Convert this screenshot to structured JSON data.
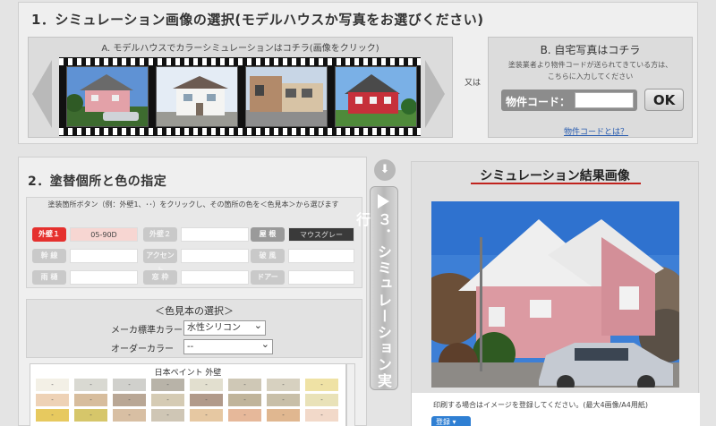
{
  "section1": {
    "title": "1．シミュレーション画像の選択(モデルハウスか写真をお選びください)",
    "model_label": "A. モデルハウスでカラーシミュレーションはコチラ(画像をクリック)",
    "or_label": "又は",
    "own_photo": {
      "title": "B. 自宅写真はコチラ",
      "desc_line1": "塗装業者より物件コードが送られてきている方は、",
      "desc_line2": "こちらに入力してください",
      "code_label": "物件コード：",
      "code_value": "",
      "ok_label": "OK",
      "help_link": "物件コードとは？"
    }
  },
  "section2": {
    "title": "2．塗替個所と色の指定",
    "instruction": "塗装箇所ボタン（例：外壁1、･･）をクリックし、その箇所の色を＜色見本＞から選びます",
    "parts": [
      {
        "label": "外壁１",
        "value": "05-90D"
      },
      {
        "label": "外壁２",
        "value": ""
      },
      {
        "label": "屋 根",
        "value": "マウスグレー"
      },
      {
        "label": "幹 線",
        "value": ""
      },
      {
        "label": "アクセント",
        "value": ""
      },
      {
        "label": "破 風",
        "value": ""
      },
      {
        "label": "雨 樋",
        "value": ""
      },
      {
        "label": "窓 枠",
        "value": ""
      },
      {
        "label": "ドアー",
        "value": ""
      }
    ],
    "swatch_title": "＜色見本の選択＞",
    "maker_label": "メーカ標準カラー",
    "maker_value": "水性シリコン",
    "order_label": "オーダーカラー",
    "order_value": "--",
    "palette_title": "日本ペイント 外壁"
  },
  "section3": {
    "button_label": "３．シミュレーション実行"
  },
  "result": {
    "title": "シミュレーション結果画像",
    "print_note": "印刷する場合はイメージを登録してください。(最大4画像/A4用紙)",
    "register_label": "登録"
  },
  "palette": [
    [
      "#f3f0e6",
      "#d9d9d2",
      "#d0d0cc",
      "#b8b3a8",
      "#e2dfcf",
      "#cfc8b6",
      "#d7d1c0",
      "#efe2a5"
    ],
    [
      "#eed2b6",
      "#d7bd9d",
      "#b9a795",
      "#d5cbb4",
      "#b19a8a",
      "#c0b49a",
      "#c8bfa8",
      "#e9e2b8"
    ],
    [
      "#e7c95f",
      "#d6c66a",
      "#d8bfa3",
      "#cfc6b5",
      "#e6c8a2",
      "#e6b89a",
      "#e0b790",
      "#f2d9c9"
    ]
  ]
}
